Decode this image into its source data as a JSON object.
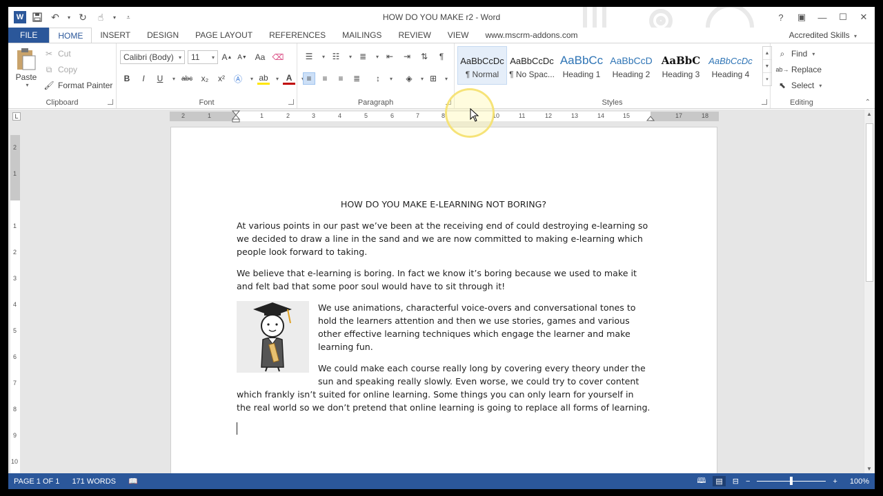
{
  "window": {
    "title": "HOW DO YOU MAKE r2 - Word",
    "controls": [
      "?",
      "▣",
      "—",
      "☐",
      "✕"
    ]
  },
  "qat": {
    "logo": "W",
    "icons": [
      "save-icon",
      "undo-icon",
      "redo-icon",
      "touch-mode-icon",
      "customize-icon"
    ]
  },
  "tabs": [
    {
      "label": "FILE"
    },
    {
      "label": "HOME"
    },
    {
      "label": "INSERT"
    },
    {
      "label": "DESIGN"
    },
    {
      "label": "PAGE LAYOUT"
    },
    {
      "label": "REFERENCES"
    },
    {
      "label": "MAILINGS"
    },
    {
      "label": "REVIEW"
    },
    {
      "label": "VIEW"
    },
    {
      "label": "www.mscrm-addons.com"
    }
  ],
  "account": "Accredited Skills",
  "clipboard": {
    "label": "Clipboard",
    "paste": "Paste",
    "cut": "Cut",
    "copy": "Copy",
    "format_painter": "Format Painter"
  },
  "font": {
    "label": "Font",
    "family": "Calibri (Body)",
    "size": "11",
    "case": "Aa",
    "bold": "B",
    "italic": "I",
    "underline": "U",
    "strike": "abc",
    "sub": "x₂",
    "sup": "x²"
  },
  "paragraph": {
    "label": "Paragraph"
  },
  "styles": {
    "label": "Styles",
    "items": [
      {
        "sample": "AaBbCcDc",
        "name": "¶ Normal"
      },
      {
        "sample": "AaBbCcDc",
        "name": "¶ No Spac..."
      },
      {
        "sample": "AaBbCc",
        "name": "Heading 1"
      },
      {
        "sample": "AaBbCcD",
        "name": "Heading 2"
      },
      {
        "sample": "AaBbC",
        "name": "Heading 3"
      },
      {
        "sample": "AaBbCcDc",
        "name": "Heading 4"
      }
    ]
  },
  "editing": {
    "label": "Editing",
    "find": "Find",
    "replace": "Replace",
    "select": "Select"
  },
  "ruler": {
    "h_numbers": [
      "2",
      "1",
      "1",
      "2",
      "3",
      "4",
      "5",
      "6",
      "7",
      "8",
      "10",
      "11",
      "12",
      "13",
      "14",
      "15",
      "17",
      "18"
    ],
    "v_numbers": [
      "2",
      "1",
      "1",
      "2",
      "3",
      "4",
      "5",
      "6",
      "7",
      "8",
      "9",
      "10"
    ]
  },
  "document": {
    "title": "HOW DO YOU MAKE E-LEARNING NOT BORING?",
    "p1": "At various points in our past we’ve been at the receiving end of could destroying e-learning so we decided to draw a line in the sand and we are now committed to making e-learning which people look forward to taking.",
    "p2": "We believe that e-learning is boring. In fact we know it’s boring because we used to make it and felt bad that some poor soul would have to sit through it!",
    "p3": "We use animations, characterful voice-overs and conversational tones to hold the learners attention and then we use stories, games and various other effective learning techniques which engage the learner and make learning fun.",
    "p4": "We could make each course really long by covering every theory under the sun and speaking really slowly. Even worse, we could try to cover content which frankly isn’t suited for online learning. Some things you can only learn for yourself in the real world so we don’t pretend that online learning is going to replace all forms of learning."
  },
  "status": {
    "page": "PAGE 1 OF 1",
    "words": "171 WORDS",
    "zoom": "100%",
    "zoom_level": 1.0
  },
  "colors": {
    "accent": "#2b579a",
    "highlight_yellow": "#f5e16e"
  }
}
